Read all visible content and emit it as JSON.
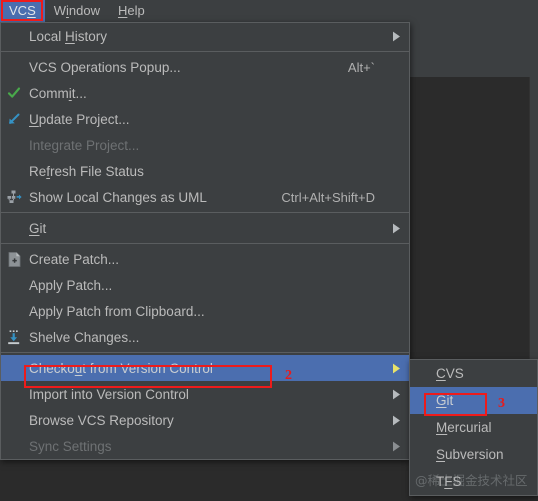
{
  "colors": {
    "menu_bg": "#3c3f41",
    "editor_bg": "#2b2b2b",
    "selection": "#4b6eaf",
    "text": "#bbbbbb",
    "text_disabled": "#6e7173",
    "separator": "#5a5d5f",
    "annotation_red": "#ee1b1b",
    "commit_check_green": "#49a94b",
    "update_arrow_blue": "#3592c4"
  },
  "menubar": {
    "items": [
      {
        "label": "VCS",
        "mnemonic_index": 2,
        "selected": true
      },
      {
        "label": "Window",
        "mnemonic_index": 1,
        "selected": false
      },
      {
        "label": "Help",
        "mnemonic_index": 0,
        "selected": false
      }
    ]
  },
  "vcs_menu": {
    "name": "VCS",
    "items": [
      {
        "label": "Local History",
        "mnemonic_index": 6,
        "icon": null,
        "shortcut": "",
        "submenu": true,
        "disabled": false,
        "selected": false
      },
      {
        "separator": true
      },
      {
        "label": "VCS Operations Popup...",
        "mnemonic_index": -1,
        "icon": null,
        "shortcut": "Alt+`",
        "submenu": false,
        "disabled": false,
        "selected": false
      },
      {
        "label": "Commit...",
        "mnemonic_index": 4,
        "icon": "check-icon",
        "shortcut": "",
        "submenu": false,
        "disabled": false,
        "selected": false
      },
      {
        "label": "Update Project...",
        "mnemonic_index": 0,
        "icon": "update-arrow-icon",
        "shortcut": "",
        "submenu": false,
        "disabled": false,
        "selected": false
      },
      {
        "label": "Integrate Project...",
        "mnemonic_index": -1,
        "icon": null,
        "shortcut": "",
        "submenu": false,
        "disabled": true,
        "selected": false
      },
      {
        "label": "Refresh File Status",
        "mnemonic_index": 2,
        "icon": null,
        "shortcut": "",
        "submenu": false,
        "disabled": false,
        "selected": false
      },
      {
        "label": "Show Local Changes as UML",
        "mnemonic_index": -1,
        "icon": "uml-diagram-icon",
        "shortcut": "Ctrl+Alt+Shift+D",
        "submenu": false,
        "disabled": false,
        "selected": false
      },
      {
        "separator": true
      },
      {
        "label": "Git",
        "mnemonic_index": 0,
        "icon": null,
        "shortcut": "",
        "submenu": true,
        "disabled": false,
        "selected": false
      },
      {
        "separator": true
      },
      {
        "label": "Create Patch...",
        "mnemonic_index": -1,
        "icon": "create-patch-icon",
        "shortcut": "",
        "submenu": false,
        "disabled": false,
        "selected": false
      },
      {
        "label": "Apply Patch...",
        "mnemonic_index": -1,
        "icon": null,
        "shortcut": "",
        "submenu": false,
        "disabled": false,
        "selected": false
      },
      {
        "label": "Apply Patch from Clipboard...",
        "mnemonic_index": -1,
        "icon": null,
        "shortcut": "",
        "submenu": false,
        "disabled": false,
        "selected": false
      },
      {
        "label": "Shelve Changes...",
        "mnemonic_index": -1,
        "icon": "shelve-changes-icon",
        "shortcut": "",
        "submenu": false,
        "disabled": false,
        "selected": false
      },
      {
        "separator": true
      },
      {
        "label": "Checkout from Version Control",
        "mnemonic_index": 6,
        "icon": null,
        "shortcut": "",
        "submenu": true,
        "disabled": false,
        "selected": true
      },
      {
        "label": "Import into Version Control",
        "mnemonic_index": -1,
        "icon": null,
        "shortcut": "",
        "submenu": true,
        "disabled": false,
        "selected": false
      },
      {
        "label": "Browse VCS Repository",
        "mnemonic_index": -1,
        "icon": null,
        "shortcut": "",
        "submenu": true,
        "disabled": false,
        "selected": false
      },
      {
        "label": "Sync Settings",
        "mnemonic_index": -1,
        "icon": null,
        "shortcut": "",
        "submenu": true,
        "disabled": true,
        "selected": false
      }
    ]
  },
  "checkout_submenu": {
    "name": "Checkout from Version Control",
    "items": [
      {
        "label": "CVS",
        "mnemonic_index": 0,
        "selected": false
      },
      {
        "label": "Git",
        "mnemonic_index": 0,
        "selected": true
      },
      {
        "label": "Mercurial",
        "mnemonic_index": 0,
        "selected": false
      },
      {
        "label": "Subversion",
        "mnemonic_index": 0,
        "selected": false
      },
      {
        "label": "TFS",
        "mnemonic_index": 1,
        "selected": false
      }
    ]
  },
  "annotations": [
    {
      "id": "step-1",
      "label": "",
      "target": "menubar-item-vcs"
    },
    {
      "id": "step-2",
      "label": "2",
      "target": "menu-item-checkout-from-version-control"
    },
    {
      "id": "step-3",
      "label": "3",
      "target": "submenu-item-git"
    }
  ],
  "watermark": {
    "text": "@稀土掘金技术社区"
  }
}
